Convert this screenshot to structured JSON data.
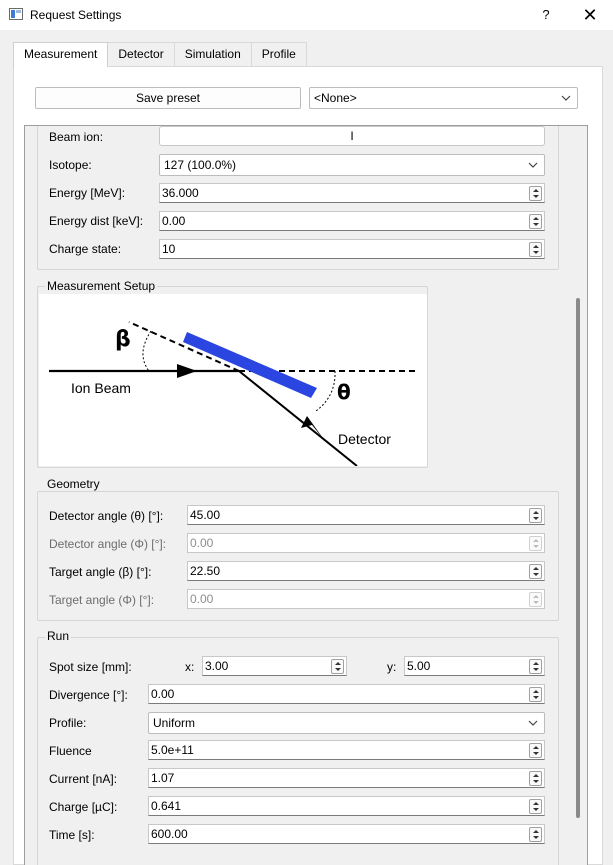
{
  "window": {
    "title": "Request Settings",
    "help": "?",
    "close": "✕"
  },
  "tabs": [
    "Measurement",
    "Detector",
    "Simulation",
    "Profile"
  ],
  "preset": {
    "save_label": "Save preset",
    "selected": "<None>"
  },
  "beam": {
    "ion_label": "Beam ion:",
    "ion_value": "I",
    "isotope_label": "Isotope:",
    "isotope_value": "127 (100.0%)",
    "energy_label": "Energy [MeV]:",
    "energy_value": "36.000",
    "energy_dist_label": "Energy dist [keV]:",
    "energy_dist_value": "0.00",
    "charge_label": "Charge state:",
    "charge_value": "10"
  },
  "setup": {
    "title": "Measurement Setup",
    "beta": "β",
    "theta": "θ",
    "ion_beam_label": "Ion Beam",
    "detector_label": "Detector"
  },
  "geometry": {
    "title": "Geometry",
    "det_theta_label": "Detector angle (θ) [°]:",
    "det_theta_value": "45.00",
    "det_phi_label": "Detector angle (Φ) [°]:",
    "det_phi_value": "0.00",
    "tgt_beta_label": "Target angle (β) [°]:",
    "tgt_beta_value": "22.50",
    "tgt_phi_label": "Target angle (Φ) [°]:",
    "tgt_phi_value": "0.00"
  },
  "run": {
    "title": "Run",
    "spot_label": "Spot size [mm]:",
    "x_label": "x:",
    "x_value": "3.00",
    "y_label": "y:",
    "y_value": "5.00",
    "divergence_label": "Divergence [°]:",
    "divergence_value": "0.00",
    "profile_label": "Profile:",
    "profile_value": "Uniform",
    "fluence_label": "Fluence",
    "fluence_value": "5.0e+11",
    "current_label": "Current [nA]:",
    "current_value": "1.07",
    "charge_label": "Charge [µC]:",
    "charge_value": "0.641",
    "time_label": "Time [s]:",
    "time_value": "600.00"
  },
  "colors": {
    "target": "#2b46e0",
    "accent": "#3d7bd6"
  }
}
